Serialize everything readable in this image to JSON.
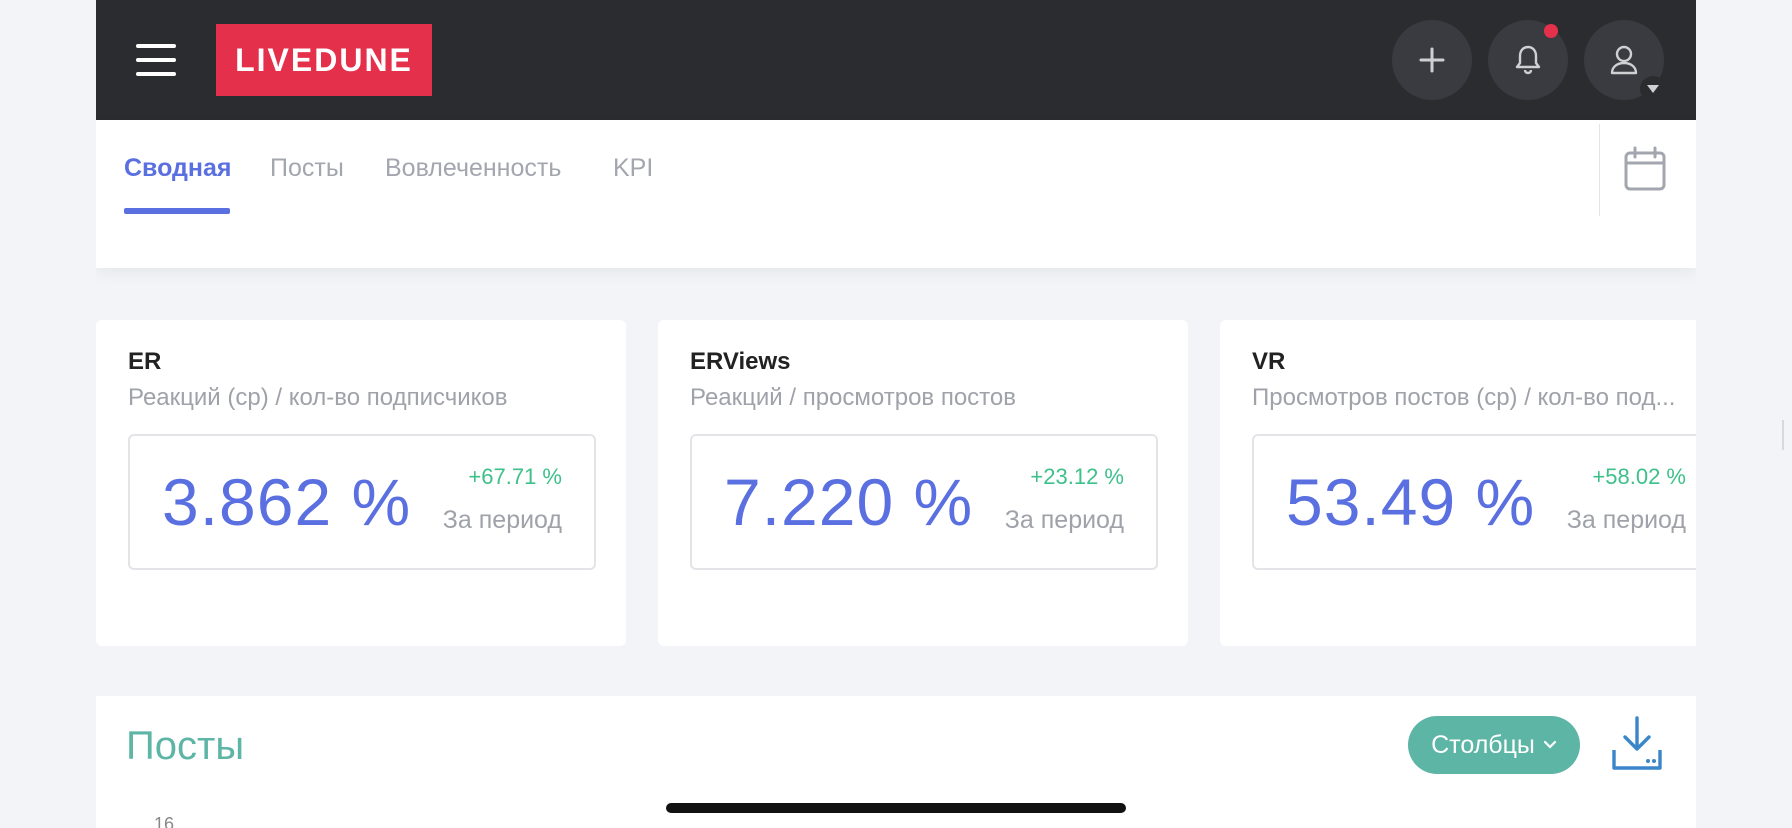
{
  "header": {
    "logo_text": "LIVEDUNE",
    "icons": [
      "menu-icon",
      "plus-icon",
      "bell-icon",
      "user-icon",
      "caret-down-icon"
    ]
  },
  "tabs": [
    {
      "label": "Сводная",
      "active": true
    },
    {
      "label": "Посты",
      "active": false
    },
    {
      "label": "Вовлеченность",
      "active": false
    },
    {
      "label": "KPI",
      "active": false
    }
  ],
  "metrics": [
    {
      "title": "ER",
      "subtitle": "Реакций (ср) / кол-во подписчиков",
      "value": "3.862 %",
      "delta": "+67.71 %",
      "period": "За период"
    },
    {
      "title": "ERViews",
      "subtitle": "Реакций / просмотров постов",
      "value": "7.220 %",
      "delta": "+23.12 %",
      "period": "За период"
    },
    {
      "title": "VR",
      "subtitle": "Просмотров постов (ср) / кол-во под...",
      "value": "53.49 %",
      "delta": "+58.02 %",
      "period": "За период"
    }
  ],
  "posts": {
    "title": "Посты",
    "columns_label": "Столбцы",
    "axis_tick": "16"
  },
  "colors": {
    "accent": "#5a6fe0",
    "teal": "#5db5a6",
    "positive": "#3ec08a",
    "brand": "#e5304c",
    "header_bg": "#2b2c30"
  }
}
